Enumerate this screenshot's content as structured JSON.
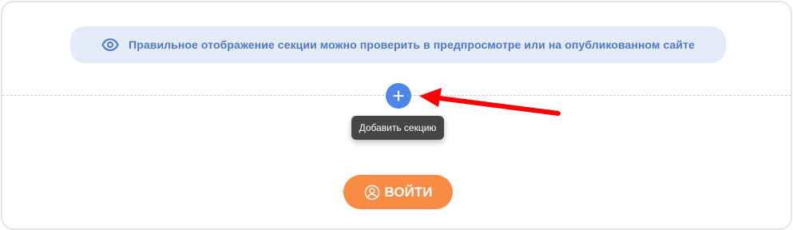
{
  "notice": {
    "icon": "eye-icon",
    "text": "Правильное отображение секции можно проверить в предпросмотре или на опубликованном сайте"
  },
  "add_section": {
    "icon": "plus-icon",
    "tooltip": "Добавить секцию"
  },
  "annotation": {
    "icon": "red-arrow-icon",
    "color": "#ff0000"
  },
  "login": {
    "icon": "user-icon",
    "label": "ВОЙТИ"
  },
  "colors": {
    "notice_bg": "#e4ebf8",
    "notice_text": "#4f79c7",
    "accent_blue": "#4e86e9",
    "login_orange": "#f98b45",
    "tooltip_bg": "#454545"
  }
}
